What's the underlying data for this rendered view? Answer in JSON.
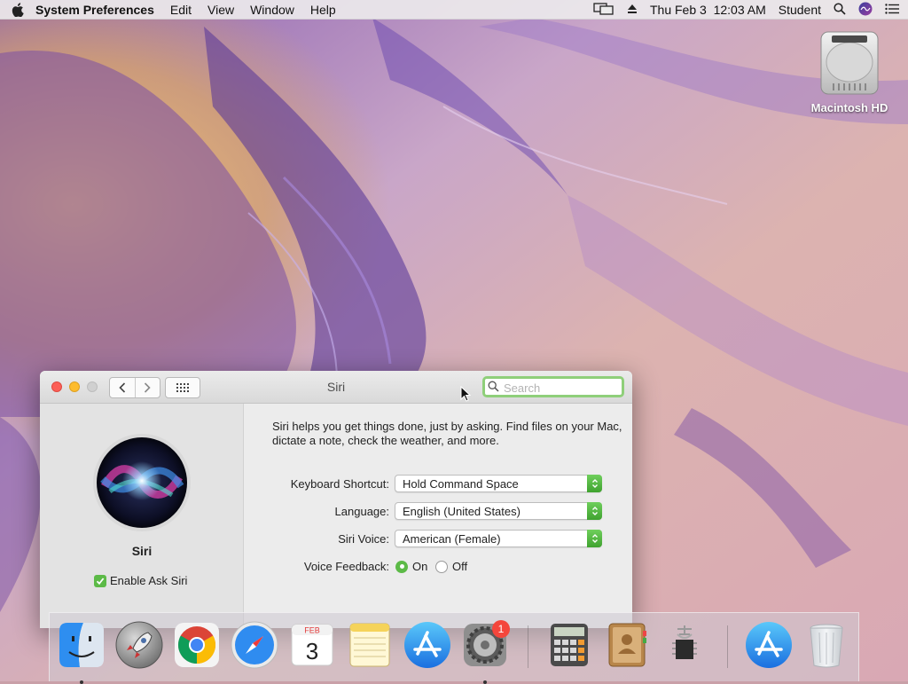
{
  "menubar": {
    "app_name": "System Preferences",
    "menus": [
      "Edit",
      "View",
      "Window",
      "Help"
    ],
    "datetime": "Thu Feb 3  12:03 AM",
    "user": "Student"
  },
  "desktop": {
    "drive_label": "Macintosh HD"
  },
  "window": {
    "title": "Siri",
    "search_placeholder": "Search",
    "sidebar": {
      "name": "Siri",
      "enable_label": "Enable Ask Siri",
      "enable_checked": true
    },
    "description": "Siri helps you get things done, just by asking. Find files on your Mac, dictate a note, check the weather, and more.",
    "settings": {
      "keyboard_shortcut": {
        "label": "Keyboard Shortcut:",
        "value": "Hold Command Space"
      },
      "language": {
        "label": "Language:",
        "value": "English (United States)"
      },
      "siri_voice": {
        "label": "Siri Voice:",
        "value": "American (Female)"
      },
      "voice_feedback": {
        "label": "Voice Feedback:",
        "on_label": "On",
        "off_label": "Off",
        "selected": "On"
      }
    }
  },
  "dock": {
    "calendar_month": "FEB",
    "calendar_day": "3",
    "badge_count": "1",
    "apps": [
      "finder-icon",
      "launchpad-icon",
      "chrome-icon",
      "safari-icon",
      "calendar-icon",
      "notes-icon",
      "app-store-icon",
      "system-preferences-icon",
      "calculator-icon",
      "contacts-icon",
      "system-information-icon",
      "app-store-icon",
      "trash-icon"
    ]
  },
  "colors": {
    "accent_green": "#5cba47",
    "close_red": "#fc5f57",
    "minimize_yellow": "#fdbc2e"
  }
}
